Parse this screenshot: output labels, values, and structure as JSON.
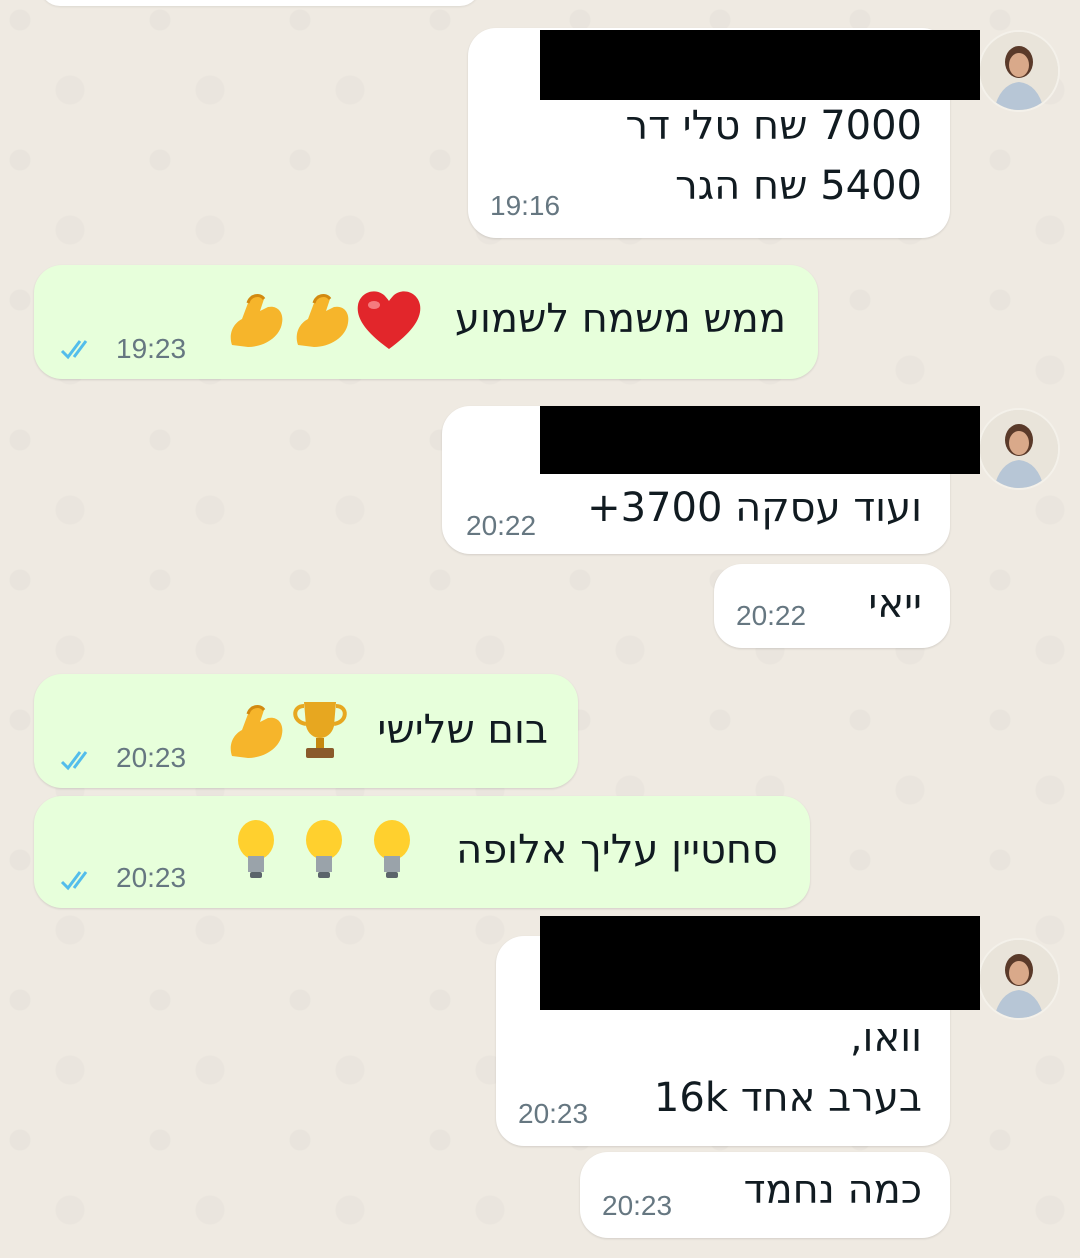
{
  "messages": [
    {
      "sender": "contact",
      "lines": [
        "7000 שח טלי דר",
        "5400 שח הגר"
      ],
      "time": "19:16"
    },
    {
      "sender": "me",
      "text": "ממש משמח לשמוע",
      "emojis": [
        "heart-icon",
        "flexed-biceps-icon",
        "flexed-biceps-icon"
      ],
      "time": "19:23",
      "status": "read"
    },
    {
      "sender": "contact",
      "text": "ועוד עסקה 3700+",
      "time": "20:22"
    },
    {
      "sender": "contact",
      "text": "ייאי",
      "time": "20:22"
    },
    {
      "sender": "me",
      "text": "בום שלישי",
      "emojis": [
        "trophy-icon",
        "flexed-biceps-icon"
      ],
      "time": "20:23",
      "status": "read"
    },
    {
      "sender": "me",
      "text": "סחטיין עליך אלופה",
      "emojis": [
        "light-bulb-icon",
        "light-bulb-icon",
        "light-bulb-icon"
      ],
      "time": "20:23",
      "status": "read"
    },
    {
      "sender": "contact",
      "lines": [
        "וואו,",
        "בערב אחד 16k"
      ],
      "time": "20:23"
    },
    {
      "sender": "contact",
      "text": "כמה נחמד",
      "time": "20:23"
    }
  ],
  "colors": {
    "background": "#efeae2",
    "incoming_bubble": "#ffffff",
    "outgoing_bubble": "#e7ffdb",
    "read_ticks": "#53bdeb",
    "time_text": "#667781"
  }
}
